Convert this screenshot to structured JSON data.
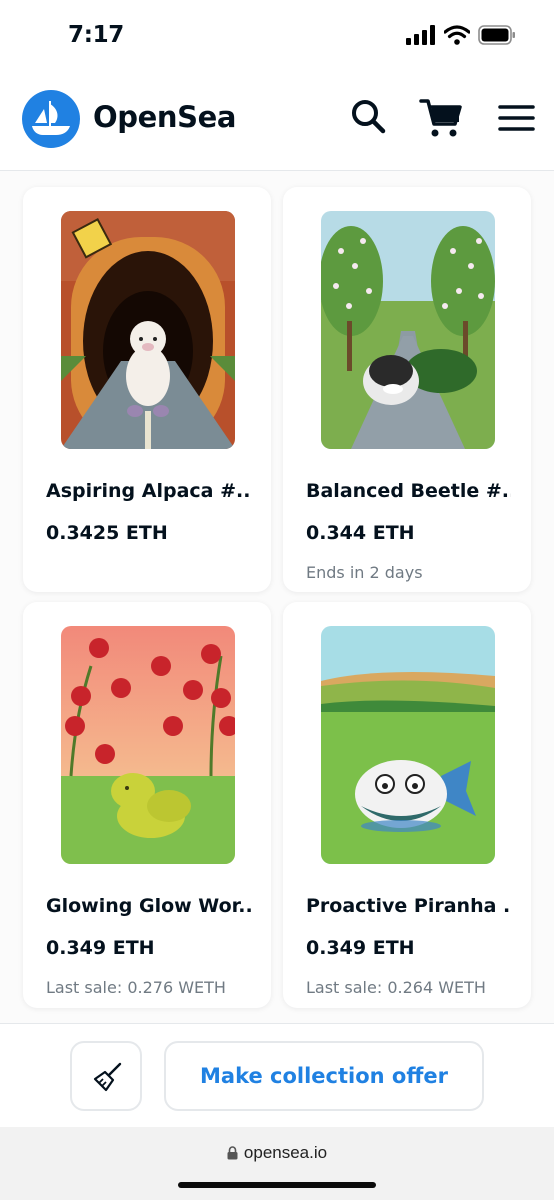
{
  "status_bar": {
    "time": "7:17"
  },
  "header": {
    "brand": "OpenSea",
    "accent_color": "#2081e2",
    "icons": [
      "opensea-logo-icon",
      "search-icon",
      "cart-icon",
      "menu-icon"
    ]
  },
  "items": [
    {
      "name": "Aspiring Alpaca #...",
      "price": "0.3425 ETH",
      "meta": ""
    },
    {
      "name": "Balanced Beetle #...",
      "price": "0.344 ETH",
      "meta": "Ends in 2 days"
    },
    {
      "name": "Glowing Glow Wor...",
      "price": "0.349 ETH",
      "meta": "Last sale: 0.276 WETH"
    },
    {
      "name": "Proactive Piranha ...",
      "price": "0.349 ETH",
      "meta": "Last sale: 0.264 WETH"
    }
  ],
  "actions": {
    "sweep_icon": "broom-icon",
    "offer_label": "Make collection offer"
  },
  "browser": {
    "url": "opensea.io"
  }
}
